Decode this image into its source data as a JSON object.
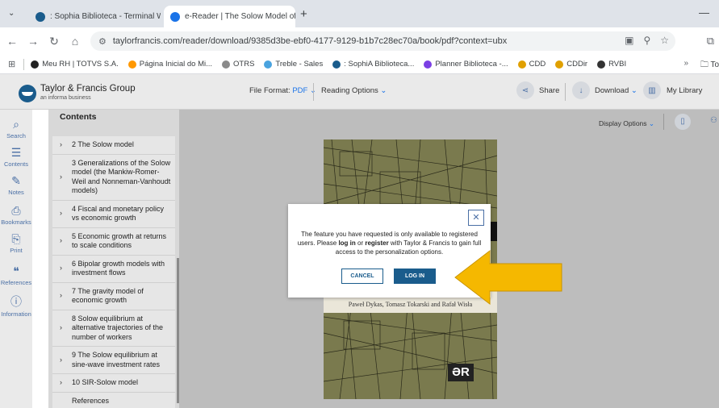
{
  "browser": {
    "tabs": [
      {
        "title": ": Sophia Biblioteca - Terminal W",
        "close": "✕",
        "favicon_color": "#1a5c8c"
      },
      {
        "title": "e-Reader | The Solow Model of",
        "close": "✕",
        "favicon_color": "#1a73e8"
      }
    ],
    "url": "taylorfrancis.com/reader/download/9385d3be-ebf0-4177-9129-b1b7c28ec70a/book/pdf?context=ubx",
    "bookmarks": [
      {
        "label": "Meu RH | TOTVS S.A.",
        "color": "#222222"
      },
      {
        "label": "Página Inicial do Mi...",
        "color": "#ff9800"
      },
      {
        "label": "OTRS",
        "color": "#8a8a8a"
      },
      {
        "label": "Treble - Sales",
        "color": "#4aa3df"
      },
      {
        "label": ": SophiA Biblioteca...",
        "color": "#1a5c8c"
      },
      {
        "label": "Planner Biblioteca -...",
        "color": "#7b3fe4"
      },
      {
        "label": "CDD",
        "color": "#e0a000"
      },
      {
        "label": "CDDir",
        "color": "#e0a000"
      },
      {
        "label": "RVBI",
        "color": "#333333"
      }
    ],
    "bookmarks_more": "»",
    "bookmarks_folder": "To"
  },
  "header": {
    "brand": "Taylor & Francis Group",
    "brand_sub": "an informa business",
    "file_format_label": "File Format:",
    "file_format_value": "PDF",
    "reading_options": "Reading Options",
    "share": "Share",
    "download": "Download",
    "my_library": "My Library"
  },
  "rail": [
    {
      "label": "Search",
      "icon": "search-icon"
    },
    {
      "label": "Contents",
      "icon": "list-icon"
    },
    {
      "label": "Notes",
      "icon": "note-icon"
    },
    {
      "label": "Bookmarks",
      "icon": "bookmark-icon"
    },
    {
      "label": "Print",
      "icon": "print-icon"
    },
    {
      "label": "References",
      "icon": "quote-icon"
    },
    {
      "label": "Information",
      "icon": "info-icon"
    }
  ],
  "contents": {
    "title": "Contents",
    "items": [
      {
        "label": "2 The Solow model",
        "arrow": true
      },
      {
        "label": "3 Generalizations of the Solow model (the Mankiw-Romer-Weil and Nonneman-Vanhoudt models)",
        "arrow": true
      },
      {
        "label": "4 Fiscal and monetary policy vs economic growth",
        "arrow": true
      },
      {
        "label": "5 Economic growth at returns to scale conditions",
        "arrow": true
      },
      {
        "label": "6 Bipolar growth models with investment flows",
        "arrow": true
      },
      {
        "label": "7 The gravity model of economic growth",
        "arrow": true
      },
      {
        "label": "8 Solow equilibrium at alternative trajectories of the number of workers",
        "arrow": true
      },
      {
        "label": "9 The Solow equilibrium at sine-wave investment rates",
        "arrow": true
      },
      {
        "label": "10 SIR-Solow model",
        "arrow": true
      },
      {
        "label": "References",
        "arrow": false
      }
    ]
  },
  "main": {
    "display_options": "Display Options",
    "cover": {
      "authors": "Paweł Dykas, Tomasz Tokarski and Rafał Wisła",
      "logo": "ƏR"
    }
  },
  "modal": {
    "text_1": "The feature you have requested is only available to registered users. Please ",
    "log_in_link": "log in",
    "text_2": " or ",
    "register_link": "register",
    "text_3": " with Taylor & Francis to gain full access to the personalization options.",
    "cancel": "CANCEL",
    "login": "LOG IN",
    "close": "✕"
  },
  "colors": {
    "accent": "#1a5c8c",
    "arrow": "#f5b800"
  }
}
